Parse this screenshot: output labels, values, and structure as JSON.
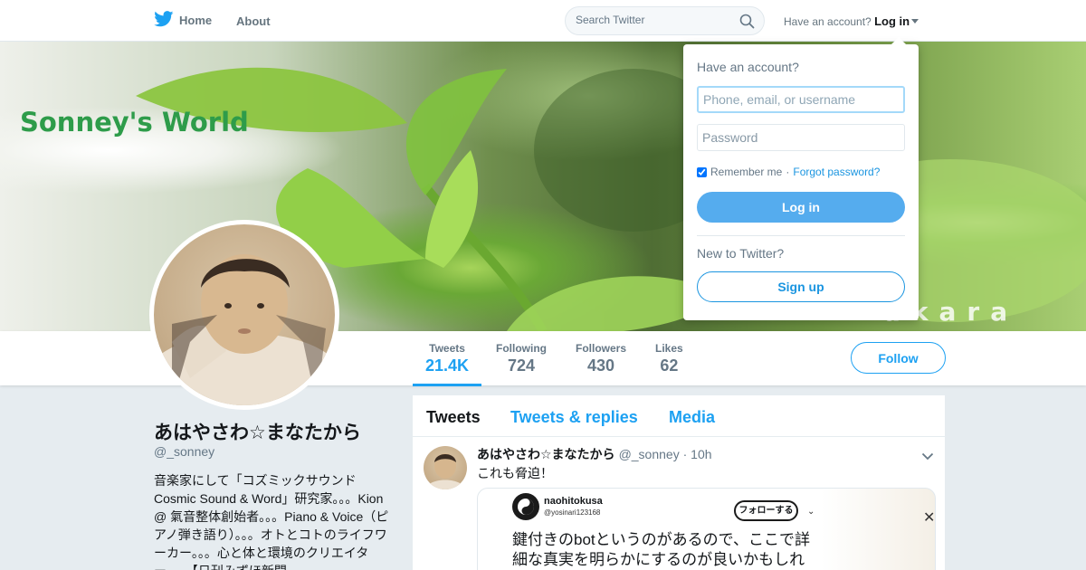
{
  "nav": {
    "home_label": "Home",
    "about_label": "About",
    "search_placeholder": "Search Twitter",
    "account_prompt": "Have an account?",
    "login_label": "Log in",
    "brand_color": "#1da1f2"
  },
  "banner": {
    "title": "Sonney's World",
    "subtitle": "akara"
  },
  "profile": {
    "name": "あはやさわ☆まなたから",
    "handle": "@_sonney",
    "bio": "音楽家にして「コズミックサウンド Cosmic Sound & Word」研究家。。。Kion @ 氣音整体創始者。。。Piano & Voice（ピアノ弾き語り）。。。オトとコトのライフワーカー。。。心と体と環境のクリエイター。。。【日刊みずほ新聞",
    "stats": [
      {
        "label": "Tweets",
        "value": "21.4K"
      },
      {
        "label": "Following",
        "value": "724"
      },
      {
        "label": "Followers",
        "value": "430"
      },
      {
        "label": "Likes",
        "value": "62"
      }
    ],
    "follow_label": "Follow"
  },
  "timeline": {
    "tabs": [
      "Tweets",
      "Tweets & replies",
      "Media"
    ],
    "tweet": {
      "name": "あはやさわ☆まなたから",
      "handle": "@_sonney",
      "time": "· 10h",
      "text": "これも脅迫！",
      "media": {
        "name": "naohitokusa",
        "handle": "@yosinari123168",
        "follow_label": "フォローする",
        "text": "鍵付きのbotというのがあるので、ここで詳細な真実を明らかにするのが良いかもしれない"
      }
    }
  },
  "login_dropdown": {
    "heading": "Have an account?",
    "username_placeholder": "Phone, email, or username",
    "password_placeholder": "Password",
    "remember_label": "Remember me",
    "separator": "·",
    "forgot_label": "Forgot password?",
    "login_button": "Log in",
    "new_prompt": "New to Twitter?",
    "signup_button": "Sign up"
  }
}
